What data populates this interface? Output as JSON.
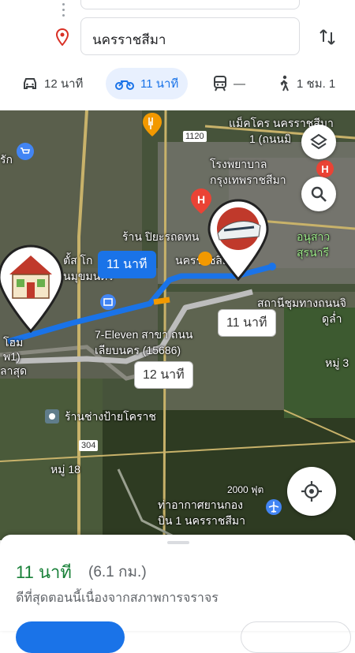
{
  "destination": {
    "value": "นครราชสีมา"
  },
  "modes": [
    {
      "icon": "car-icon",
      "label": "12 นาที"
    },
    {
      "icon": "motorcycle-icon",
      "label": "11 นาที"
    },
    {
      "icon": "transit-icon",
      "label": "—"
    },
    {
      "icon": "walk-icon",
      "label": "1 ชม. 1"
    }
  ],
  "map": {
    "labels": {
      "l1": "แม็คโคร นครราชสีมา",
      "l2": "1 (ถนนมิ",
      "l3": "1120",
      "l4": "โรงพยาบาล",
      "l5": "กรุงเทพราชสีมา",
      "l6": "ร้าน ปิยะรถดทน",
      "l7": "อนุสาว",
      "l8": "สุรนารี",
      "l9": "นครราชสีมา",
      "l10": "สถานีชุมทางถนนจิ",
      "l11": "ดูล่ำ",
      "l12": "7-Eleven สาขา ถนน",
      "l13": "เลียบนคร (15686)",
      "l14": "หมู่ 3",
      "l15": "ร้านช่างป้ายโคราช",
      "l16": "304",
      "l17": "หมู่ 18",
      "l18": "2000 ฟุต",
      "l19": "ท่าอากาศยานกอง",
      "l20": "บิน 1 นครราชสีมา",
      "l21": "รัก",
      "l22": "ตั้ส โก",
      "l23": "นมุขมนตร",
      "l24": "โฮม",
      "l25": "พ1)",
      "l26": "ลาสุด"
    },
    "bubbles": {
      "b1": "11 นาที",
      "b2": "11 นาที",
      "b3": "12 นาที"
    }
  },
  "sheet": {
    "time": "11 นาที",
    "distance": "(6.1 กม.)",
    "description": "ดีที่สุดตอนนี้เนื่องจากสภาพการจราจร"
  },
  "colors": {
    "accent": "#1a73e8",
    "time_green": "#188038",
    "route_blue": "#1a73e8",
    "route_gray": "#bdbdbd"
  }
}
